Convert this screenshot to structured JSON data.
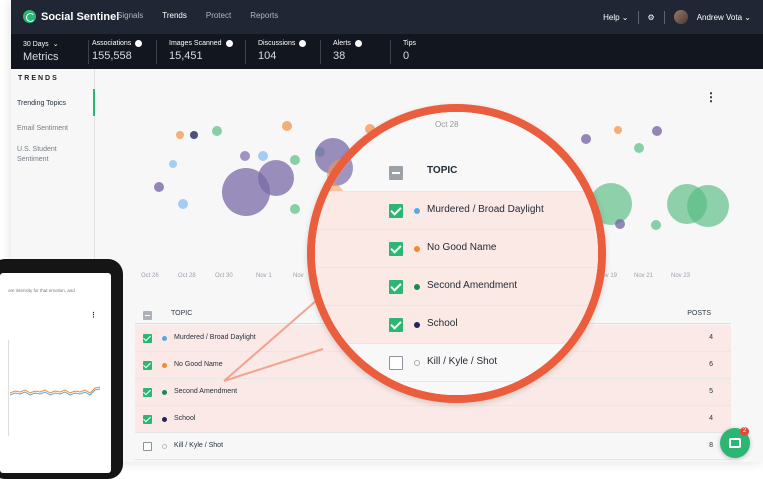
{
  "app": {
    "logo": "Social Sentinel",
    "nav": [
      "Signals",
      "Trends",
      "Protect",
      "Reports"
    ],
    "active_nav": "Trends",
    "help": "Help",
    "user": "Andrew Vota"
  },
  "metrics": [
    {
      "key": "30 Days",
      "value": "Metrics"
    },
    {
      "key": "Associations",
      "value": "155,558"
    },
    {
      "key": "Images Scanned",
      "value": "15,451"
    },
    {
      "key": "Discussions",
      "value": "104"
    },
    {
      "key": "Alerts",
      "value": "38"
    },
    {
      "key": "Tips",
      "value": "0"
    }
  ],
  "sidebar": {
    "title": "TRENDS",
    "items": [
      "Trending Topics",
      "Email Sentiment",
      "U.S. Student Sentiment"
    ]
  },
  "chart": {
    "xticks": [
      "Oct 26",
      "Oct 28",
      "Oct 30",
      "Nov 1",
      "Nov",
      "Nov 19",
      "Nov 21",
      "Nov 23"
    ],
    "zoom_tick": "Oct 28"
  },
  "table": {
    "header": "TOPIC",
    "posts_header": "POSTS",
    "rows": [
      {
        "topic": "Murdered / Broad Daylight",
        "posts": "4",
        "color": "#5aa9e6",
        "checked": true
      },
      {
        "topic": "No Good Name",
        "posts": "6",
        "color": "#f18a2d",
        "checked": true
      },
      {
        "topic": "Second Amendment",
        "posts": "5",
        "color": "#1b8a4f",
        "checked": true
      },
      {
        "topic": "School",
        "posts": "4",
        "color": "#24245a",
        "checked": true
      },
      {
        "topic": "Kill / Kyle / Shot",
        "posts": "8",
        "color": "#bbbbbb",
        "checked": false
      }
    ]
  },
  "tablet": {
    "caption": "ore intensity for that emotion, and"
  },
  "chat_badge": "2"
}
